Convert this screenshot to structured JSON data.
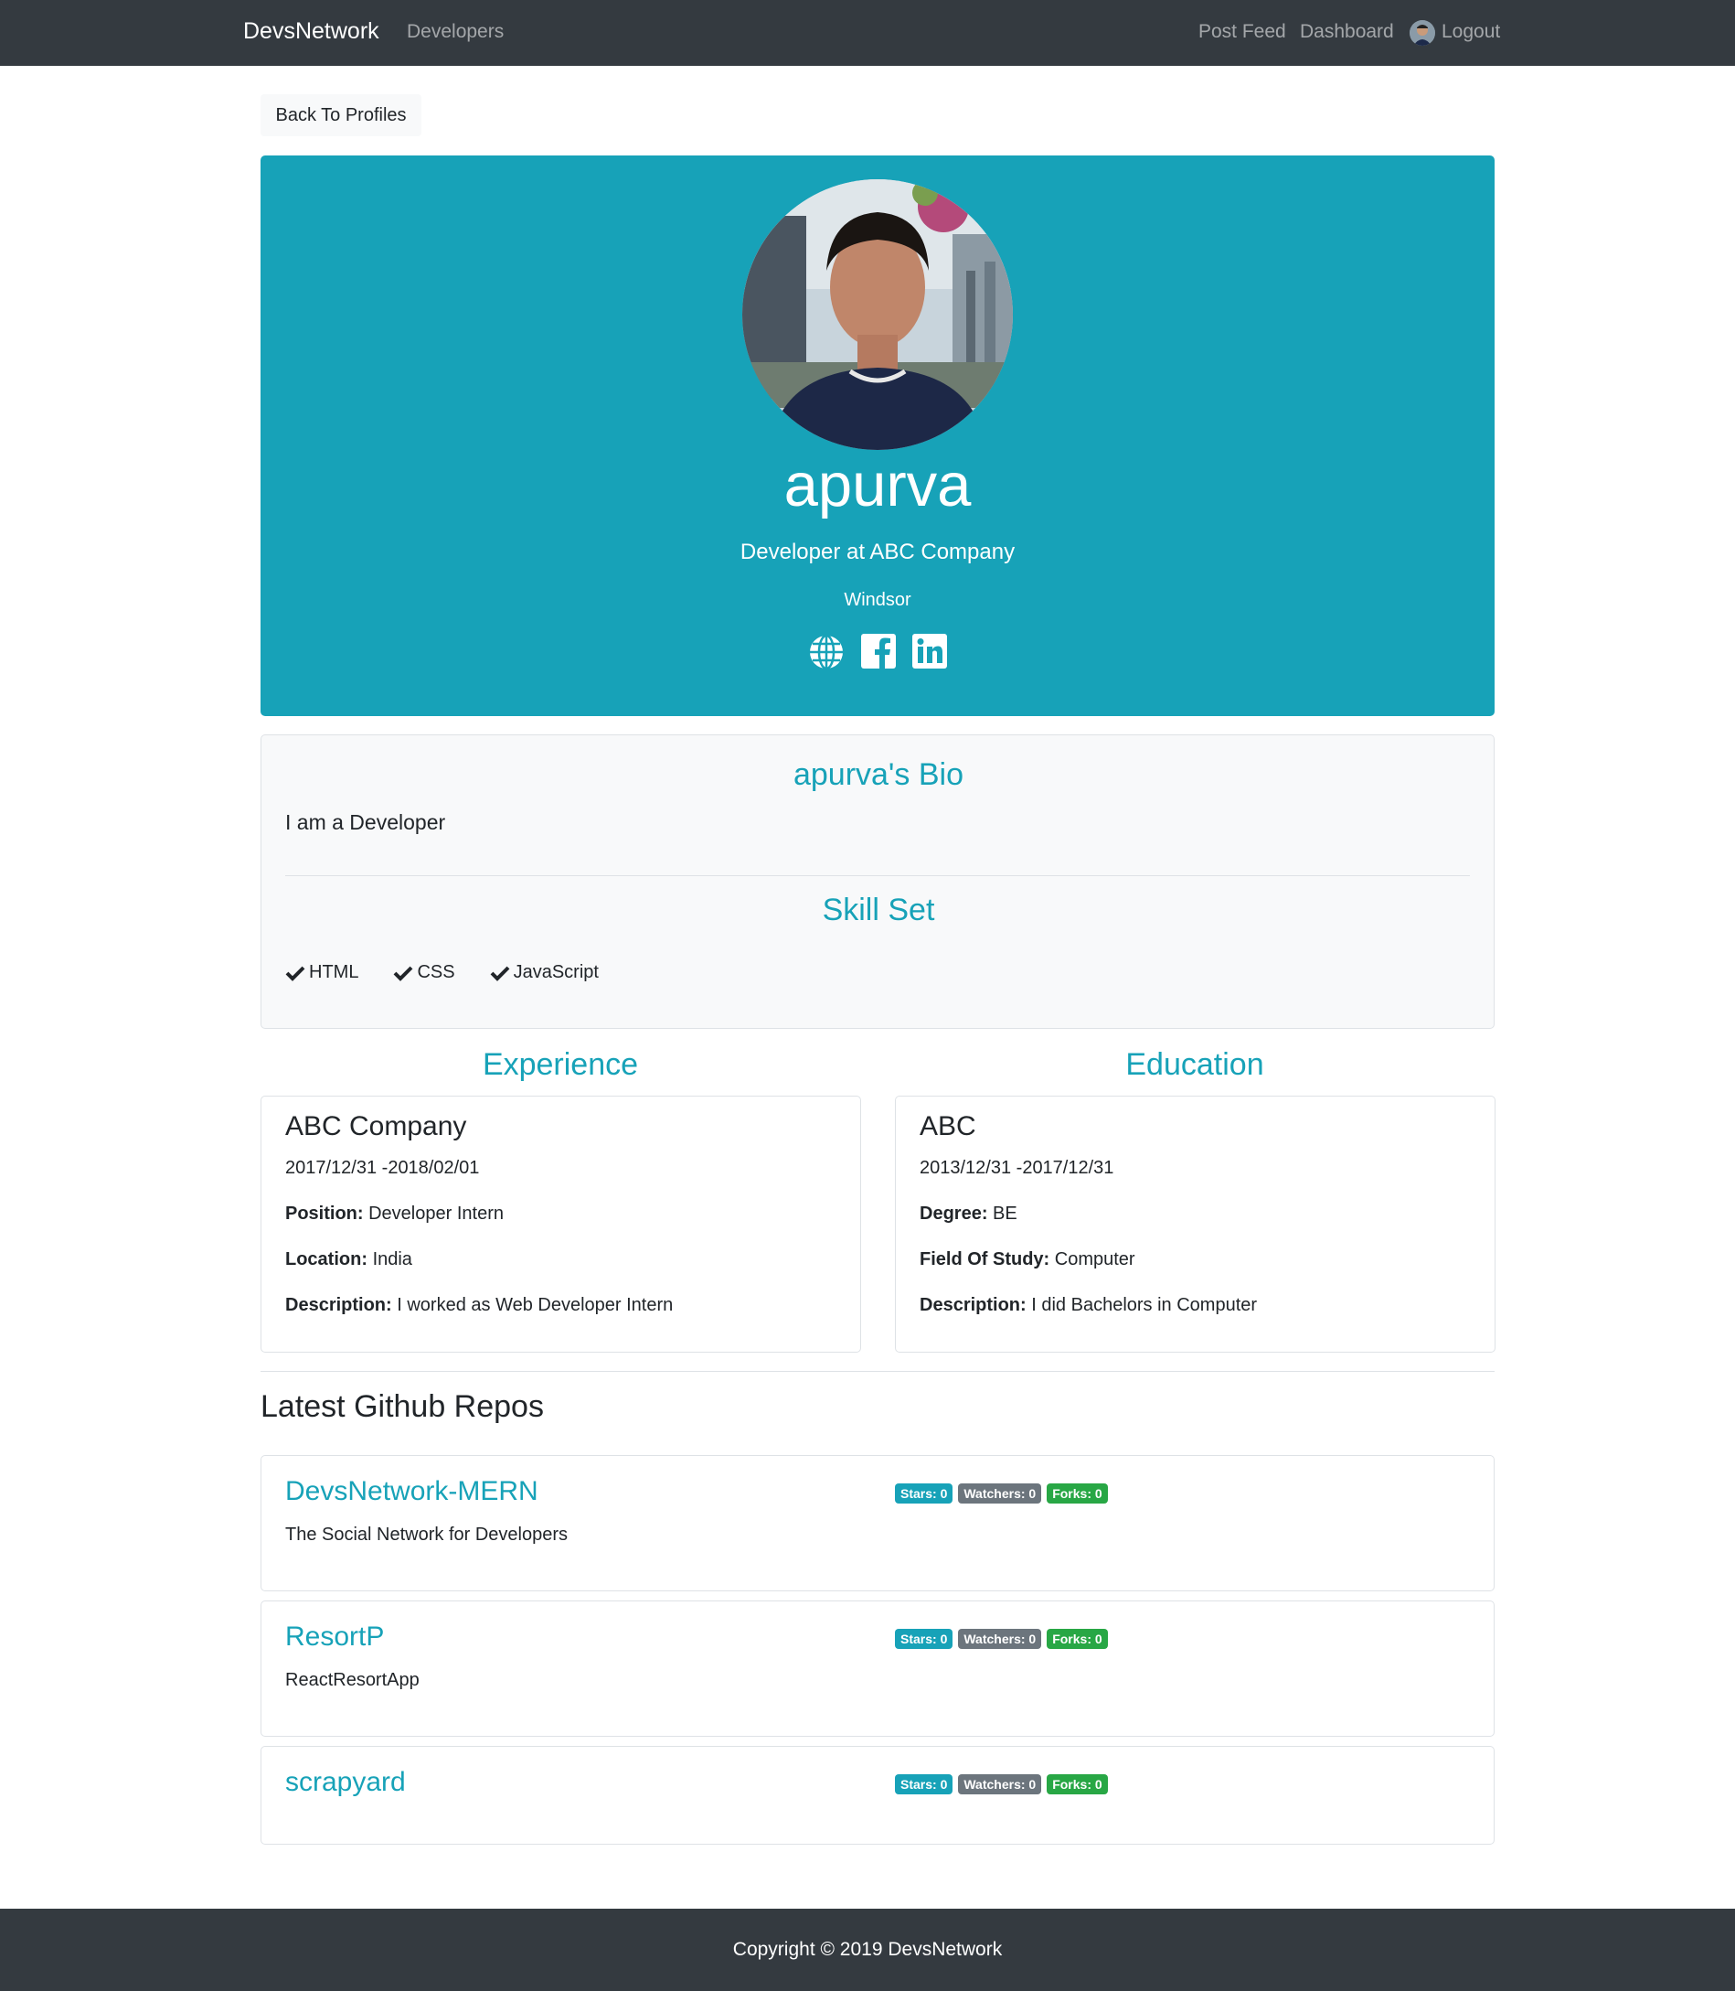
{
  "navbar": {
    "brand": "DevsNetwork",
    "developers": "Developers",
    "post_feed": "Post Feed",
    "dashboard": "Dashboard",
    "logout": "Logout"
  },
  "back_button": "Back To Profiles",
  "profile": {
    "name": "apurva",
    "status": "Developer at ABC Company",
    "location": "Windsor",
    "socials": [
      "globe-icon",
      "facebook-icon",
      "linkedin-icon"
    ]
  },
  "about": {
    "bio_title": "apurva's Bio",
    "bio": "I am a Developer",
    "skills_title": "Skill Set",
    "skills": [
      "HTML",
      "CSS",
      "JavaScript"
    ]
  },
  "experience": {
    "title": "Experience",
    "company": "ABC Company",
    "dates": "2017/12/31 -2018/02/01",
    "position_label": "Position:",
    "position": "Developer Intern",
    "location_label": "Location:",
    "location": "India",
    "description_label": "Description:",
    "description": "I worked as Web Developer Intern"
  },
  "education": {
    "title": "Education",
    "school": "ABC",
    "dates": "2013/12/31 -2017/12/31",
    "degree_label": "Degree:",
    "degree": "BE",
    "field_label": "Field Of Study:",
    "field": "Computer",
    "description_label": "Description:",
    "description": "I did Bachelors in Computer"
  },
  "repos": {
    "title": "Latest Github Repos",
    "items": [
      {
        "name": "DevsNetwork-MERN",
        "description": "The Social Network for Developers",
        "stars": "Stars: 0",
        "watchers": "Watchers: 0",
        "forks": "Forks: 0"
      },
      {
        "name": "ResortP",
        "description": "ReactResortApp",
        "stars": "Stars: 0",
        "watchers": "Watchers: 0",
        "forks": "Forks: 0"
      },
      {
        "name": "scrapyard",
        "description": "",
        "stars": "Stars: 0",
        "watchers": "Watchers: 0",
        "forks": "Forks: 0"
      }
    ]
  },
  "footer": {
    "copyright": "Copyright © 2019 DevsNetwork"
  },
  "colors": {
    "navbar": "#343a40",
    "accent": "#17a2b8",
    "badge_stars": "#17a2b8",
    "badge_watchers": "#6c757d",
    "badge_forks": "#28a745"
  }
}
